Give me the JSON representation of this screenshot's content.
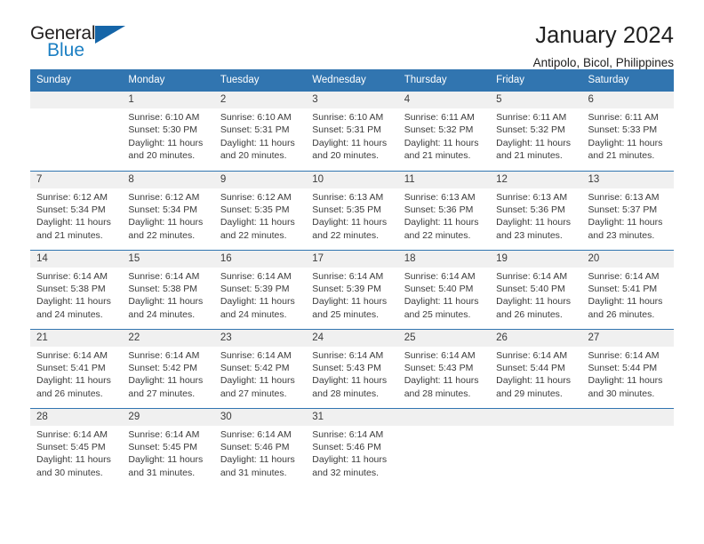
{
  "brand": {
    "name_line1": "General",
    "name_line2": "Blue",
    "flag_icon": "triangle-flag-icon",
    "color_dark": "#221f1f",
    "color_blue": "#1b7fc3"
  },
  "header": {
    "title": "January 2024",
    "subtitle": "Antipolo, Bicol, Philippines"
  },
  "theme": {
    "header_blue": "#3175b0",
    "date_band_gray": "#f0f0f0",
    "text_gray": "#3b3b3b"
  },
  "calendar": {
    "weekday_headers": [
      "Sunday",
      "Monday",
      "Tuesday",
      "Wednesday",
      "Thursday",
      "Friday",
      "Saturday"
    ],
    "weeks": [
      [
        {
          "date": "",
          "blank": true,
          "sunrise": "",
          "sunset": "",
          "daylight_line1": "",
          "daylight_line2": ""
        },
        {
          "date": "1",
          "blank": false,
          "sunrise": "Sunrise: 6:10 AM",
          "sunset": "Sunset: 5:30 PM",
          "daylight_line1": "Daylight: 11 hours",
          "daylight_line2": "and 20 minutes."
        },
        {
          "date": "2",
          "blank": false,
          "sunrise": "Sunrise: 6:10 AM",
          "sunset": "Sunset: 5:31 PM",
          "daylight_line1": "Daylight: 11 hours",
          "daylight_line2": "and 20 minutes."
        },
        {
          "date": "3",
          "blank": false,
          "sunrise": "Sunrise: 6:10 AM",
          "sunset": "Sunset: 5:31 PM",
          "daylight_line1": "Daylight: 11 hours",
          "daylight_line2": "and 20 minutes."
        },
        {
          "date": "4",
          "blank": false,
          "sunrise": "Sunrise: 6:11 AM",
          "sunset": "Sunset: 5:32 PM",
          "daylight_line1": "Daylight: 11 hours",
          "daylight_line2": "and 21 minutes."
        },
        {
          "date": "5",
          "blank": false,
          "sunrise": "Sunrise: 6:11 AM",
          "sunset": "Sunset: 5:32 PM",
          "daylight_line1": "Daylight: 11 hours",
          "daylight_line2": "and 21 minutes."
        },
        {
          "date": "6",
          "blank": false,
          "sunrise": "Sunrise: 6:11 AM",
          "sunset": "Sunset: 5:33 PM",
          "daylight_line1": "Daylight: 11 hours",
          "daylight_line2": "and 21 minutes."
        }
      ],
      [
        {
          "date": "7",
          "blank": false,
          "sunrise": "Sunrise: 6:12 AM",
          "sunset": "Sunset: 5:34 PM",
          "daylight_line1": "Daylight: 11 hours",
          "daylight_line2": "and 21 minutes."
        },
        {
          "date": "8",
          "blank": false,
          "sunrise": "Sunrise: 6:12 AM",
          "sunset": "Sunset: 5:34 PM",
          "daylight_line1": "Daylight: 11 hours",
          "daylight_line2": "and 22 minutes."
        },
        {
          "date": "9",
          "blank": false,
          "sunrise": "Sunrise: 6:12 AM",
          "sunset": "Sunset: 5:35 PM",
          "daylight_line1": "Daylight: 11 hours",
          "daylight_line2": "and 22 minutes."
        },
        {
          "date": "10",
          "blank": false,
          "sunrise": "Sunrise: 6:13 AM",
          "sunset": "Sunset: 5:35 PM",
          "daylight_line1": "Daylight: 11 hours",
          "daylight_line2": "and 22 minutes."
        },
        {
          "date": "11",
          "blank": false,
          "sunrise": "Sunrise: 6:13 AM",
          "sunset": "Sunset: 5:36 PM",
          "daylight_line1": "Daylight: 11 hours",
          "daylight_line2": "and 22 minutes."
        },
        {
          "date": "12",
          "blank": false,
          "sunrise": "Sunrise: 6:13 AM",
          "sunset": "Sunset: 5:36 PM",
          "daylight_line1": "Daylight: 11 hours",
          "daylight_line2": "and 23 minutes."
        },
        {
          "date": "13",
          "blank": false,
          "sunrise": "Sunrise: 6:13 AM",
          "sunset": "Sunset: 5:37 PM",
          "daylight_line1": "Daylight: 11 hours",
          "daylight_line2": "and 23 minutes."
        }
      ],
      [
        {
          "date": "14",
          "blank": false,
          "sunrise": "Sunrise: 6:14 AM",
          "sunset": "Sunset: 5:38 PM",
          "daylight_line1": "Daylight: 11 hours",
          "daylight_line2": "and 24 minutes."
        },
        {
          "date": "15",
          "blank": false,
          "sunrise": "Sunrise: 6:14 AM",
          "sunset": "Sunset: 5:38 PM",
          "daylight_line1": "Daylight: 11 hours",
          "daylight_line2": "and 24 minutes."
        },
        {
          "date": "16",
          "blank": false,
          "sunrise": "Sunrise: 6:14 AM",
          "sunset": "Sunset: 5:39 PM",
          "daylight_line1": "Daylight: 11 hours",
          "daylight_line2": "and 24 minutes."
        },
        {
          "date": "17",
          "blank": false,
          "sunrise": "Sunrise: 6:14 AM",
          "sunset": "Sunset: 5:39 PM",
          "daylight_line1": "Daylight: 11 hours",
          "daylight_line2": "and 25 minutes."
        },
        {
          "date": "18",
          "blank": false,
          "sunrise": "Sunrise: 6:14 AM",
          "sunset": "Sunset: 5:40 PM",
          "daylight_line1": "Daylight: 11 hours",
          "daylight_line2": "and 25 minutes."
        },
        {
          "date": "19",
          "blank": false,
          "sunrise": "Sunrise: 6:14 AM",
          "sunset": "Sunset: 5:40 PM",
          "daylight_line1": "Daylight: 11 hours",
          "daylight_line2": "and 26 minutes."
        },
        {
          "date": "20",
          "blank": false,
          "sunrise": "Sunrise: 6:14 AM",
          "sunset": "Sunset: 5:41 PM",
          "daylight_line1": "Daylight: 11 hours",
          "daylight_line2": "and 26 minutes."
        }
      ],
      [
        {
          "date": "21",
          "blank": false,
          "sunrise": "Sunrise: 6:14 AM",
          "sunset": "Sunset: 5:41 PM",
          "daylight_line1": "Daylight: 11 hours",
          "daylight_line2": "and 26 minutes."
        },
        {
          "date": "22",
          "blank": false,
          "sunrise": "Sunrise: 6:14 AM",
          "sunset": "Sunset: 5:42 PM",
          "daylight_line1": "Daylight: 11 hours",
          "daylight_line2": "and 27 minutes."
        },
        {
          "date": "23",
          "blank": false,
          "sunrise": "Sunrise: 6:14 AM",
          "sunset": "Sunset: 5:42 PM",
          "daylight_line1": "Daylight: 11 hours",
          "daylight_line2": "and 27 minutes."
        },
        {
          "date": "24",
          "blank": false,
          "sunrise": "Sunrise: 6:14 AM",
          "sunset": "Sunset: 5:43 PM",
          "daylight_line1": "Daylight: 11 hours",
          "daylight_line2": "and 28 minutes."
        },
        {
          "date": "25",
          "blank": false,
          "sunrise": "Sunrise: 6:14 AM",
          "sunset": "Sunset: 5:43 PM",
          "daylight_line1": "Daylight: 11 hours",
          "daylight_line2": "and 28 minutes."
        },
        {
          "date": "26",
          "blank": false,
          "sunrise": "Sunrise: 6:14 AM",
          "sunset": "Sunset: 5:44 PM",
          "daylight_line1": "Daylight: 11 hours",
          "daylight_line2": "and 29 minutes."
        },
        {
          "date": "27",
          "blank": false,
          "sunrise": "Sunrise: 6:14 AM",
          "sunset": "Sunset: 5:44 PM",
          "daylight_line1": "Daylight: 11 hours",
          "daylight_line2": "and 30 minutes."
        }
      ],
      [
        {
          "date": "28",
          "blank": false,
          "sunrise": "Sunrise: 6:14 AM",
          "sunset": "Sunset: 5:45 PM",
          "daylight_line1": "Daylight: 11 hours",
          "daylight_line2": "and 30 minutes."
        },
        {
          "date": "29",
          "blank": false,
          "sunrise": "Sunrise: 6:14 AM",
          "sunset": "Sunset: 5:45 PM",
          "daylight_line1": "Daylight: 11 hours",
          "daylight_line2": "and 31 minutes."
        },
        {
          "date": "30",
          "blank": false,
          "sunrise": "Sunrise: 6:14 AM",
          "sunset": "Sunset: 5:46 PM",
          "daylight_line1": "Daylight: 11 hours",
          "daylight_line2": "and 31 minutes."
        },
        {
          "date": "31",
          "blank": false,
          "sunrise": "Sunrise: 6:14 AM",
          "sunset": "Sunset: 5:46 PM",
          "daylight_line1": "Daylight: 11 hours",
          "daylight_line2": "and 32 minutes."
        },
        {
          "date": "",
          "blank": true,
          "sunrise": "",
          "sunset": "",
          "daylight_line1": "",
          "daylight_line2": ""
        },
        {
          "date": "",
          "blank": true,
          "sunrise": "",
          "sunset": "",
          "daylight_line1": "",
          "daylight_line2": ""
        },
        {
          "date": "",
          "blank": true,
          "sunrise": "",
          "sunset": "",
          "daylight_line1": "",
          "daylight_line2": ""
        }
      ]
    ]
  }
}
